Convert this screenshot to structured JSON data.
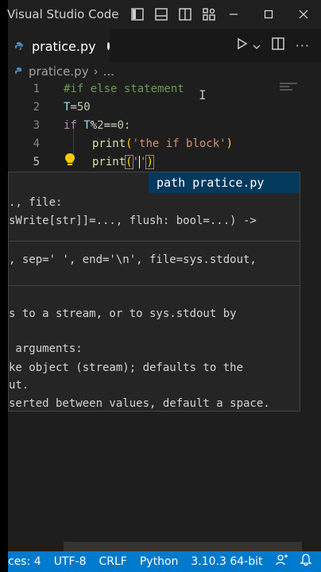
{
  "window": {
    "title": "Visual Studio Code"
  },
  "tab": {
    "label": "pratice.py"
  },
  "breadcrumb": {
    "file": "pratice.py",
    "more": "..."
  },
  "code_lines": [
    {
      "num": "1",
      "text": "#if else statement"
    },
    {
      "num": "2",
      "text": "T=50"
    },
    {
      "num": "3",
      "text": "if T%2==0:"
    },
    {
      "num": "4",
      "text": "    print('the if block')"
    },
    {
      "num": "5",
      "text": "    print('')"
    }
  ],
  "code_tokens": {
    "l2_var": "T",
    "l2_eq": "=",
    "l2_num": "50",
    "l3_kw": "if",
    "l3_var": " T",
    "l3_op": "%",
    "l3_num1": "2",
    "l3_op2": "==",
    "l3_num2": "0",
    "l3_colon": ":",
    "l4_fn": "print",
    "l4_open": "(",
    "l4_str": "'the if block'",
    "l4_close": ")",
    "l5_fn": "print",
    "l5_open": "(",
    "l5_q1": "'",
    "l5_q2": "'",
    "l5_close": ")"
  },
  "hover": {
    "header": "path pratice.py",
    "lines": [
      "., file:",
      "sWrite[str]]=..., flush: bool=...) ->",
      ", sep=' ', end='\\n', file=sys.stdout,",
      "s to a stream, or to sys.stdout by",
      " arguments:",
      "ke object (stream); defaults to the",
      "ut.",
      "serted between values, default a space."
    ]
  },
  "statusbar": {
    "spaces": "ces: 4",
    "encoding": "UTF-8",
    "eol": "CRLF",
    "language": "Python",
    "interpreter": "3.10.3 64-bit"
  },
  "colors": {
    "status": "#007acc",
    "editor_bg": "#1e1e1e",
    "hover_header": "#04395e"
  }
}
